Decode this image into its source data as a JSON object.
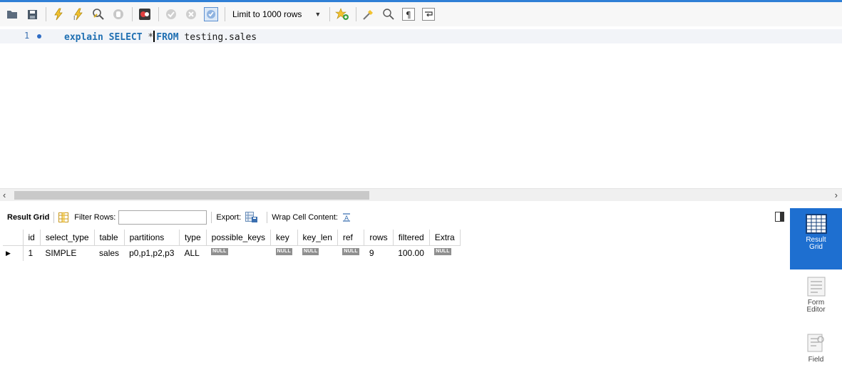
{
  "toolbar": {
    "limit_select": {
      "value": "Limit to 1000 rows"
    },
    "icons": [
      "folder-icon",
      "save-icon",
      "execute-icon",
      "execute-current-icon",
      "explain-icon",
      "stop-icon",
      "toggle-error-icon",
      "commit-icon",
      "rollback-icon",
      "autocommit-icon",
      "bookmark-icon",
      "beautify-icon",
      "find-icon",
      "invisible-chars-icon",
      "word-wrap-icon"
    ]
  },
  "editor": {
    "line_number": "1",
    "code": {
      "kw1": "explain",
      "kw2": "SELECT",
      "star": "*",
      "kw3": "FROM",
      "table": "testing.sales"
    }
  },
  "result_toolbar": {
    "result_grid": "Result Grid",
    "filter_rows": "Filter Rows:",
    "filter_value": "",
    "export": "Export:",
    "wrap": "Wrap Cell Content:"
  },
  "grid": {
    "columns": [
      "id",
      "select_type",
      "table",
      "partitions",
      "type",
      "possible_keys",
      "key",
      "key_len",
      "ref",
      "rows",
      "filtered",
      "Extra"
    ],
    "row": {
      "id": "1",
      "select_type": "SIMPLE",
      "table": "sales",
      "partitions": "p0,p1,p2,p3",
      "type": "ALL",
      "possible_keys": "NULL",
      "key": "NULL",
      "key_len": "NULL",
      "ref": "NULL",
      "rows": "9",
      "filtered": "100.00",
      "Extra": "NULL"
    }
  },
  "sidebar": {
    "result_grid_1": "Result",
    "result_grid_2": "Grid",
    "form_editor_1": "Form",
    "form_editor_2": "Editor",
    "field_types_1": "Field"
  },
  "colors": {
    "accent": "#1e6fd0",
    "keyword": "#1f6fb2",
    "null_badge": "#8f8f8f"
  }
}
